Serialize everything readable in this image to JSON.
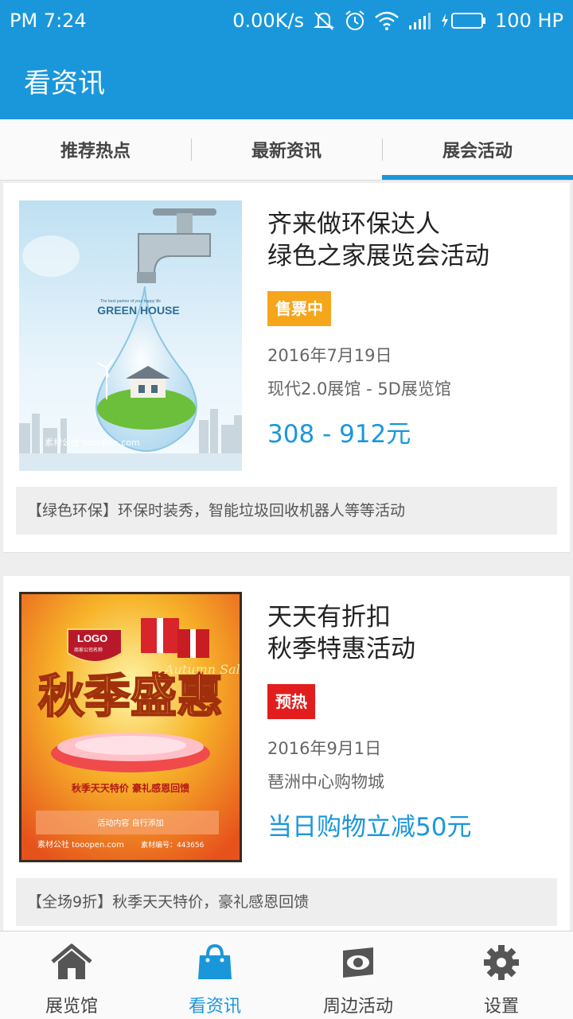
{
  "status_bar": {
    "time": "PM 7:24",
    "speed": "0.00K/s",
    "battery": "100 HP"
  },
  "app_bar": {
    "title": "看资讯"
  },
  "tabs": [
    {
      "label": "推荐热点",
      "active": false
    },
    {
      "label": "最新资讯",
      "active": false
    },
    {
      "label": "展会活动",
      "active": true
    }
  ],
  "events": [
    {
      "title_line1": "齐来做环保达人",
      "title_line2": "绿色之家展览会活动",
      "status": "售票中",
      "status_color": "#f5a61b",
      "date": "2016年7月19日",
      "venue": "现代2.0展馆 - 5D展览馆",
      "price": "308 - 912元",
      "note": "【绿色环保】环保时装秀，智能垃圾回收机器人等等活动",
      "poster": {
        "tagline": "The best partner of your happy life",
        "headline": "GREEN HOUSE",
        "watermark": "素材公社 tooopen.com"
      }
    },
    {
      "title_line1": "天天有折扣",
      "title_line2": "秋季特惠活动",
      "status": "预热",
      "status_color": "#e21d1d",
      "date": "2016年9月1日",
      "venue": "琶洲中心购物城",
      "price": "当日购物立减50元",
      "note": "【全场9折】秋季天天特价，豪礼感恩回馈",
      "poster": {
        "logo": "LOGO",
        "company": "商家公司名称",
        "headline": "秋季盛惠",
        "script": "Autumn Sale",
        "slogan": "秋季天天特价  豪礼感恩回馈",
        "content_label": "活动内容 自行添加",
        "watermark": "素材公社 tooopen.com",
        "code": "素材编号：443656"
      }
    }
  ],
  "bottom_nav": [
    {
      "label": "展览馆",
      "icon": "house-icon",
      "active": false
    },
    {
      "label": "看资讯",
      "icon": "shopping-bag-icon",
      "active": true
    },
    {
      "label": "周边活动",
      "icon": "eye-icon",
      "active": false
    },
    {
      "label": "设置",
      "icon": "gear-icon",
      "active": false
    }
  ],
  "colors": {
    "primary": "#1a97db",
    "badge_selling": "#f5a61b",
    "badge_preheat": "#e21d1d"
  }
}
